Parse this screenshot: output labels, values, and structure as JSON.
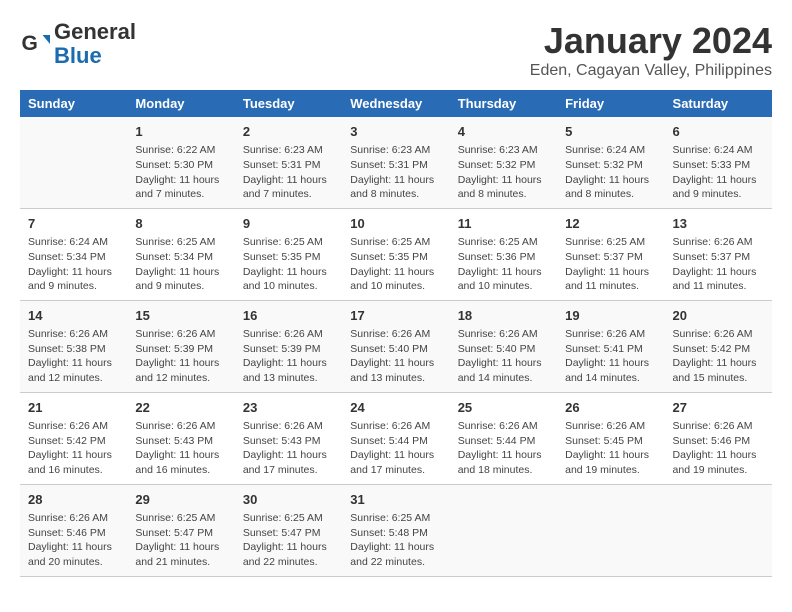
{
  "header": {
    "logo_line1": "General",
    "logo_line2": "Blue",
    "month": "January 2024",
    "location": "Eden, Cagayan Valley, Philippines"
  },
  "columns": [
    "Sunday",
    "Monday",
    "Tuesday",
    "Wednesday",
    "Thursday",
    "Friday",
    "Saturday"
  ],
  "rows": [
    [
      {
        "day": "",
        "text": ""
      },
      {
        "day": "1",
        "text": "Sunrise: 6:22 AM\nSunset: 5:30 PM\nDaylight: 11 hours and 7 minutes."
      },
      {
        "day": "2",
        "text": "Sunrise: 6:23 AM\nSunset: 5:31 PM\nDaylight: 11 hours and 7 minutes."
      },
      {
        "day": "3",
        "text": "Sunrise: 6:23 AM\nSunset: 5:31 PM\nDaylight: 11 hours and 8 minutes."
      },
      {
        "day": "4",
        "text": "Sunrise: 6:23 AM\nSunset: 5:32 PM\nDaylight: 11 hours and 8 minutes."
      },
      {
        "day": "5",
        "text": "Sunrise: 6:24 AM\nSunset: 5:32 PM\nDaylight: 11 hours and 8 minutes."
      },
      {
        "day": "6",
        "text": "Sunrise: 6:24 AM\nSunset: 5:33 PM\nDaylight: 11 hours and 9 minutes."
      }
    ],
    [
      {
        "day": "7",
        "text": "Sunrise: 6:24 AM\nSunset: 5:34 PM\nDaylight: 11 hours and 9 minutes."
      },
      {
        "day": "8",
        "text": "Sunrise: 6:25 AM\nSunset: 5:34 PM\nDaylight: 11 hours and 9 minutes."
      },
      {
        "day": "9",
        "text": "Sunrise: 6:25 AM\nSunset: 5:35 PM\nDaylight: 11 hours and 10 minutes."
      },
      {
        "day": "10",
        "text": "Sunrise: 6:25 AM\nSunset: 5:35 PM\nDaylight: 11 hours and 10 minutes."
      },
      {
        "day": "11",
        "text": "Sunrise: 6:25 AM\nSunset: 5:36 PM\nDaylight: 11 hours and 10 minutes."
      },
      {
        "day": "12",
        "text": "Sunrise: 6:25 AM\nSunset: 5:37 PM\nDaylight: 11 hours and 11 minutes."
      },
      {
        "day": "13",
        "text": "Sunrise: 6:26 AM\nSunset: 5:37 PM\nDaylight: 11 hours and 11 minutes."
      }
    ],
    [
      {
        "day": "14",
        "text": "Sunrise: 6:26 AM\nSunset: 5:38 PM\nDaylight: 11 hours and 12 minutes."
      },
      {
        "day": "15",
        "text": "Sunrise: 6:26 AM\nSunset: 5:39 PM\nDaylight: 11 hours and 12 minutes."
      },
      {
        "day": "16",
        "text": "Sunrise: 6:26 AM\nSunset: 5:39 PM\nDaylight: 11 hours and 13 minutes."
      },
      {
        "day": "17",
        "text": "Sunrise: 6:26 AM\nSunset: 5:40 PM\nDaylight: 11 hours and 13 minutes."
      },
      {
        "day": "18",
        "text": "Sunrise: 6:26 AM\nSunset: 5:40 PM\nDaylight: 11 hours and 14 minutes."
      },
      {
        "day": "19",
        "text": "Sunrise: 6:26 AM\nSunset: 5:41 PM\nDaylight: 11 hours and 14 minutes."
      },
      {
        "day": "20",
        "text": "Sunrise: 6:26 AM\nSunset: 5:42 PM\nDaylight: 11 hours and 15 minutes."
      }
    ],
    [
      {
        "day": "21",
        "text": "Sunrise: 6:26 AM\nSunset: 5:42 PM\nDaylight: 11 hours and 16 minutes."
      },
      {
        "day": "22",
        "text": "Sunrise: 6:26 AM\nSunset: 5:43 PM\nDaylight: 11 hours and 16 minutes."
      },
      {
        "day": "23",
        "text": "Sunrise: 6:26 AM\nSunset: 5:43 PM\nDaylight: 11 hours and 17 minutes."
      },
      {
        "day": "24",
        "text": "Sunrise: 6:26 AM\nSunset: 5:44 PM\nDaylight: 11 hours and 17 minutes."
      },
      {
        "day": "25",
        "text": "Sunrise: 6:26 AM\nSunset: 5:44 PM\nDaylight: 11 hours and 18 minutes."
      },
      {
        "day": "26",
        "text": "Sunrise: 6:26 AM\nSunset: 5:45 PM\nDaylight: 11 hours and 19 minutes."
      },
      {
        "day": "27",
        "text": "Sunrise: 6:26 AM\nSunset: 5:46 PM\nDaylight: 11 hours and 19 minutes."
      }
    ],
    [
      {
        "day": "28",
        "text": "Sunrise: 6:26 AM\nSunset: 5:46 PM\nDaylight: 11 hours and 20 minutes."
      },
      {
        "day": "29",
        "text": "Sunrise: 6:25 AM\nSunset: 5:47 PM\nDaylight: 11 hours and 21 minutes."
      },
      {
        "day": "30",
        "text": "Sunrise: 6:25 AM\nSunset: 5:47 PM\nDaylight: 11 hours and 22 minutes."
      },
      {
        "day": "31",
        "text": "Sunrise: 6:25 AM\nSunset: 5:48 PM\nDaylight: 11 hours and 22 minutes."
      },
      {
        "day": "",
        "text": ""
      },
      {
        "day": "",
        "text": ""
      },
      {
        "day": "",
        "text": ""
      }
    ]
  ]
}
